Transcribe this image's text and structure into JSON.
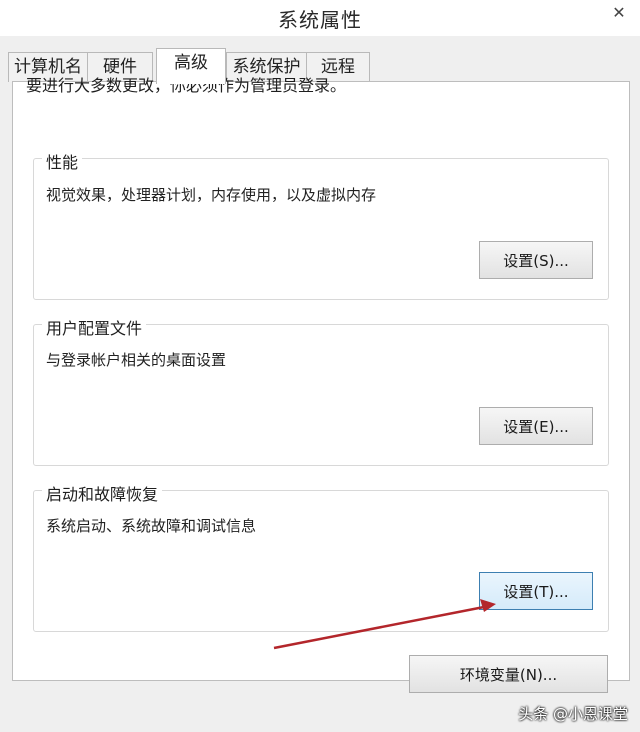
{
  "window": {
    "title": "系统属性",
    "close_glyph": "✕"
  },
  "tabs": [
    {
      "label": "计算机名"
    },
    {
      "label": "硬件"
    },
    {
      "label": "高级",
      "active": true
    },
    {
      "label": "系统保护"
    },
    {
      "label": "远程"
    }
  ],
  "notice": "要进行大多数更改，你必须作为管理员登录。",
  "groups": {
    "performance": {
      "title": "性能",
      "description": "视觉效果，处理器计划，内存使用，以及虚拟内存",
      "button": "设置(S)..."
    },
    "user_profiles": {
      "title": "用户配置文件",
      "description": "与登录帐户相关的桌面设置",
      "button": "设置(E)..."
    },
    "startup_recovery": {
      "title": "启动和故障恢复",
      "description": "系统启动、系统故障和调试信息",
      "button": "设置(T)..."
    }
  },
  "env_button": "环境变量(N)...",
  "annotation": {
    "arrow_color": "#b3262b"
  },
  "watermark": "头条 @小恩课堂"
}
